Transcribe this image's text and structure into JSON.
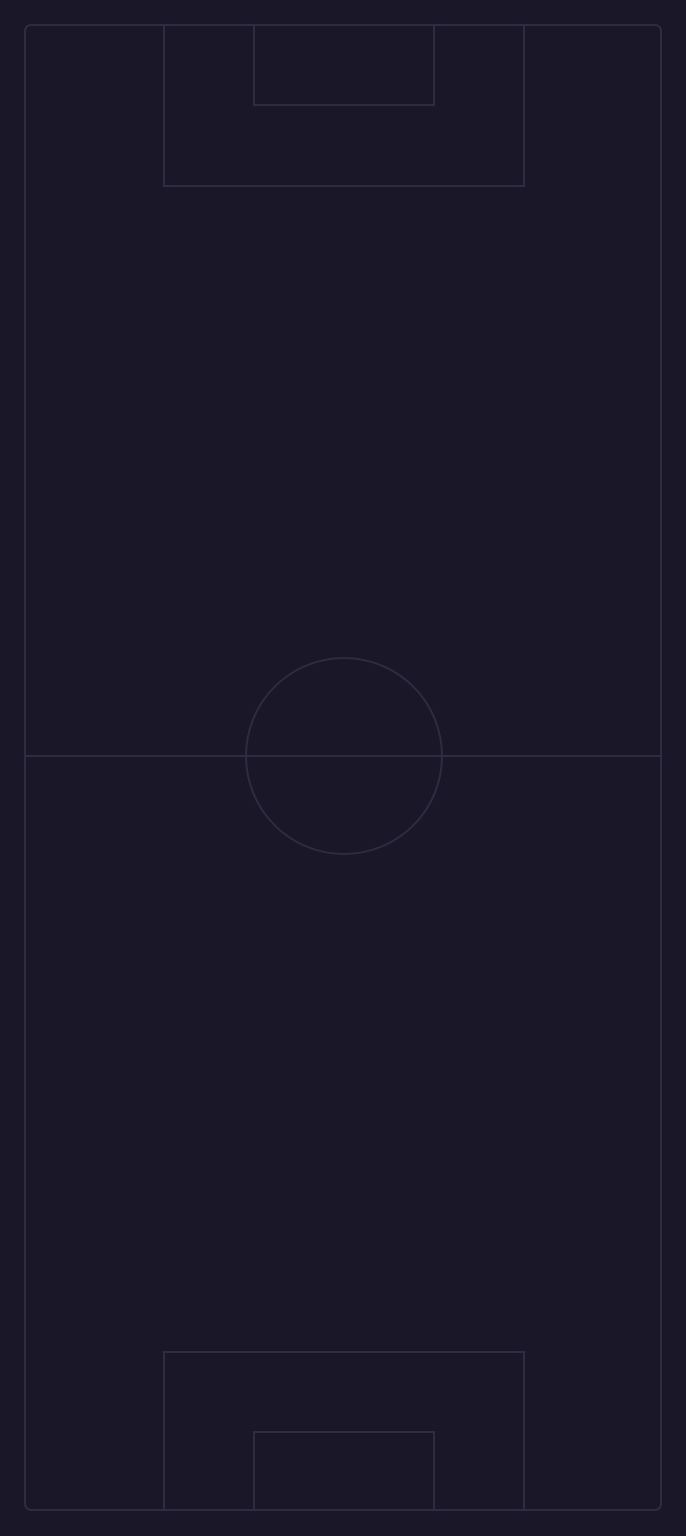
{
  "screen": {
    "background": "#1a1729",
    "line_color": "#2f2b40"
  },
  "pitch": {
    "orientation": "vertical",
    "markings": [
      "outer-boundary",
      "halfway-line",
      "center-circle",
      "top-penalty-area",
      "top-goal-area",
      "bottom-penalty-area",
      "bottom-goal-area"
    ]
  }
}
